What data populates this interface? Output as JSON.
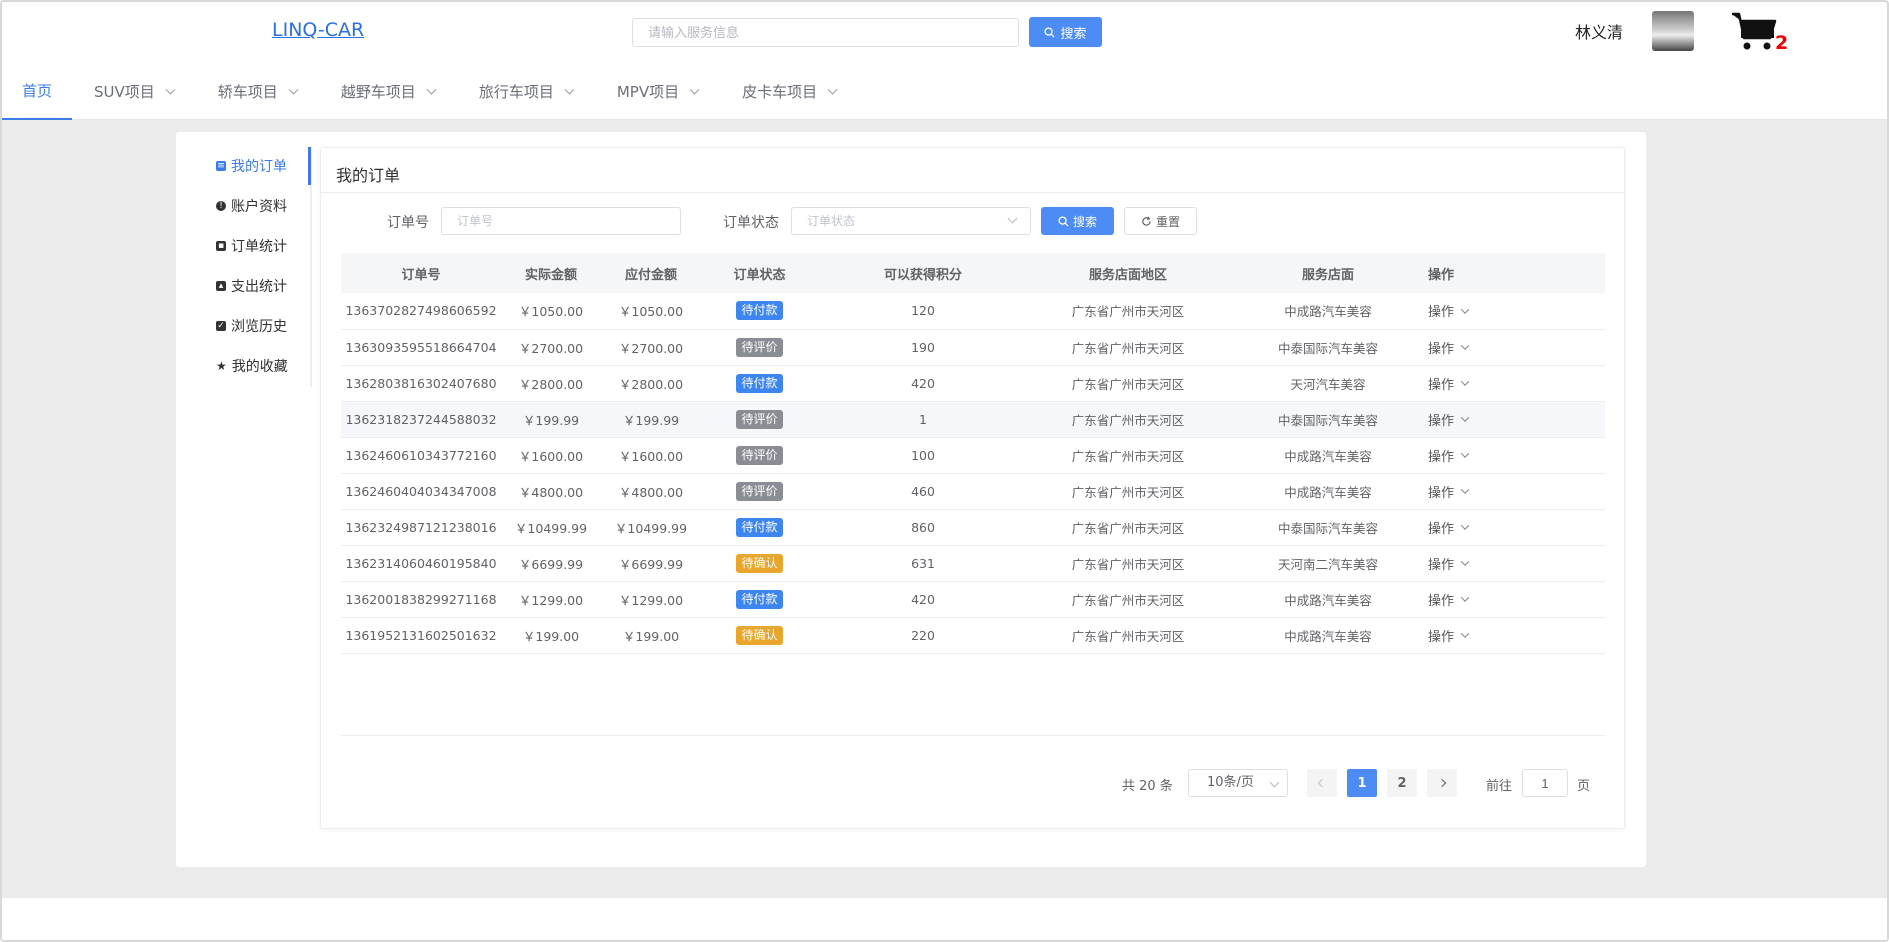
{
  "app": {
    "logo": "LINQ-CAR",
    "search_placeholder": "请输入服务信息",
    "search_button": "搜索",
    "username": "林义清",
    "cart_count": "2"
  },
  "nav": [
    {
      "label": "首页",
      "active": true
    },
    {
      "label": "SUV项目"
    },
    {
      "label": "轿车项目"
    },
    {
      "label": "越野车项目"
    },
    {
      "label": "旅行车项目"
    },
    {
      "label": "MPV项目"
    },
    {
      "label": "皮卡车项目"
    }
  ],
  "sidebar": [
    {
      "label": "我的订单",
      "active": true,
      "icon": "list-icon"
    },
    {
      "label": "账户资料",
      "icon": "info-icon"
    },
    {
      "label": "订单统计",
      "icon": "ticket-icon"
    },
    {
      "label": "支出统计",
      "icon": "thumbs-icon"
    },
    {
      "label": "浏览历史",
      "icon": "clipboard-icon"
    },
    {
      "label": "我的收藏",
      "icon": "star-icon"
    }
  ],
  "panel": {
    "title": "我的订单",
    "order_no_label": "订单号",
    "order_no_placeholder": "订单号",
    "status_label": "订单状态",
    "status_placeholder": "订单状态",
    "search_button": "搜索",
    "reset_button": "重置"
  },
  "table": {
    "columns": [
      "订单号",
      "实际金额",
      "应付金额",
      "订单状态",
      "可以获得积分",
      "服务店面地区",
      "服务店面",
      "操作"
    ],
    "status_colors": {
      "待付款": "#3d86f2",
      "待评价": "#8a8d93",
      "待确认": "#eaa52c"
    },
    "rows": [
      {
        "order_no": "1363702827498606592",
        "actual": "￥1050.00",
        "payable": "￥1050.00",
        "status": "待付款",
        "points": "120",
        "region": "广东省广州市天河区",
        "store": "中成路汽车美容",
        "op": "操作"
      },
      {
        "order_no": "1363093595518664704",
        "actual": "￥2700.00",
        "payable": "￥2700.00",
        "status": "待评价",
        "points": "190",
        "region": "广东省广州市天河区",
        "store": "中泰国际汽车美容",
        "op": "操作"
      },
      {
        "order_no": "1362803816302407680",
        "actual": "￥2800.00",
        "payable": "￥2800.00",
        "status": "待付款",
        "points": "420",
        "region": "广东省广州市天河区",
        "store": "天河汽车美容",
        "op": "操作"
      },
      {
        "order_no": "1362318237244588032",
        "actual": "￥199.99",
        "payable": "￥199.99",
        "status": "待评价",
        "points": "1",
        "region": "广东省广州市天河区",
        "store": "中泰国际汽车美容",
        "op": "操作",
        "hover": true
      },
      {
        "order_no": "1362460610343772160",
        "actual": "￥1600.00",
        "payable": "￥1600.00",
        "status": "待评价",
        "points": "100",
        "region": "广东省广州市天河区",
        "store": "中成路汽车美容",
        "op": "操作"
      },
      {
        "order_no": "1362460404034347008",
        "actual": "￥4800.00",
        "payable": "￥4800.00",
        "status": "待评价",
        "points": "460",
        "region": "广东省广州市天河区",
        "store": "中成路汽车美容",
        "op": "操作"
      },
      {
        "order_no": "1362324987121238016",
        "actual": "￥10499.99",
        "payable": "￥10499.99",
        "status": "待付款",
        "points": "860",
        "region": "广东省广州市天河区",
        "store": "中泰国际汽车美容",
        "op": "操作"
      },
      {
        "order_no": "1362314060460195840",
        "actual": "￥6699.99",
        "payable": "￥6699.99",
        "status": "待确认",
        "points": "631",
        "region": "广东省广州市天河区",
        "store": "天河南二汽车美容",
        "op": "操作"
      },
      {
        "order_no": "1362001838299271168",
        "actual": "￥1299.00",
        "payable": "￥1299.00",
        "status": "待付款",
        "points": "420",
        "region": "广东省广州市天河区",
        "store": "中成路汽车美容",
        "op": "操作"
      },
      {
        "order_no": "1361952131602501632",
        "actual": "￥199.00",
        "payable": "￥199.00",
        "status": "待确认",
        "points": "220",
        "region": "广东省广州市天河区",
        "store": "中成路汽车美容",
        "op": "操作"
      }
    ]
  },
  "pagination": {
    "total": "共 20 条",
    "page_size": "10条/页",
    "pages": [
      "1",
      "2"
    ],
    "current": "1",
    "goto_label": "前往",
    "goto_value": "1",
    "goto_suffix": "页"
  }
}
